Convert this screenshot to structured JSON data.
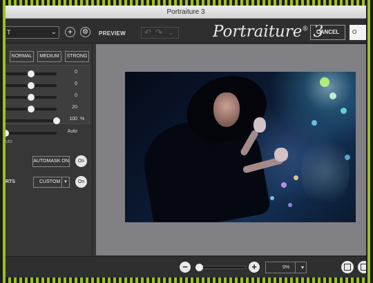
{
  "window": {
    "title": "Portraiture 3"
  },
  "toolbar": {
    "preset_value": "T",
    "add_icon": "plus-icon",
    "settings_icon": "gear-icon",
    "preview_label": "PREVIEW",
    "undo_icon": "undo-icon",
    "redo_icon": "redo-icon",
    "history_icon": "chevron-down-icon",
    "app_name": "Portraiture",
    "app_version": "3",
    "cancel_label": "CANCEL",
    "ok_label": "O"
  },
  "presets": {
    "normal": "NORMAL",
    "medium": "MEDIUM",
    "strong": "STRONG"
  },
  "sliders": [
    {
      "value": "0",
      "level": 0.5
    },
    {
      "value": "0",
      "level": 0.5
    },
    {
      "value": "0",
      "level": 0.5
    },
    {
      "value": "20",
      "level": 0.5
    },
    {
      "value": "100",
      "unit": "%",
      "level": 1.0
    },
    {
      "value": "Auto",
      "level": 0.0
    }
  ],
  "auto_text": "uto",
  "mask": {
    "automask_label": "AUTOMASK ON",
    "toggle_label": "On"
  },
  "enhancements": {
    "row_label": "RTS",
    "custom_label": "CUSTOM",
    "toggle_label": "On"
  },
  "zoom": {
    "value": "9%",
    "level": 0.05,
    "minus_label": "−",
    "plus_label": "+"
  },
  "colors": {
    "accent": "#9bc21a",
    "panel": "#373737",
    "preview_bg": "#808085"
  }
}
